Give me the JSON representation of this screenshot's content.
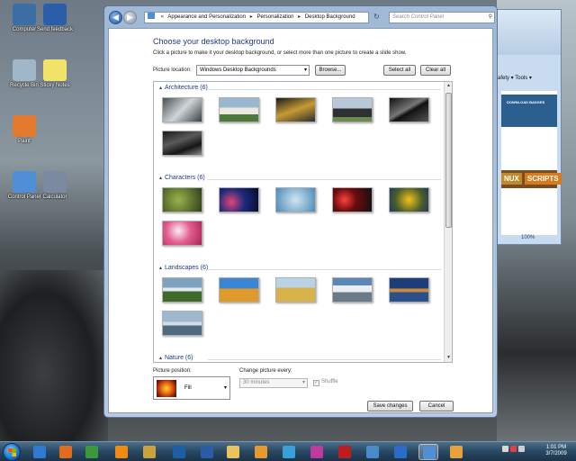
{
  "desktop": {
    "icons": [
      {
        "label": "Computer",
        "name": "computer-icon",
        "color": "#3a6ea5"
      },
      {
        "label": "Send feedback",
        "name": "send-feedback-icon",
        "color": "#2b5ea8"
      },
      {
        "label": "Recycle Bin",
        "name": "recycle-bin-icon",
        "color": "#9fb7c9"
      },
      {
        "label": "Sticky Notes",
        "name": "sticky-notes-icon",
        "color": "#f2e36b"
      },
      {
        "label": "Paint",
        "name": "paint-icon",
        "color": "#e27b2d"
      },
      {
        "label": "Control Panel",
        "name": "control-panel-icon",
        "color": "#4f8fd6"
      },
      {
        "label": "Calculator",
        "name": "calculator-icon",
        "color": "#7c8aa0"
      }
    ]
  },
  "ie_window": {
    "tools_label": "afety ▾   Tools ▾",
    "band_text": "DOWNLOAD BADGES",
    "linux_text": "NUX",
    "scripts_text": "SCRIPTS",
    "zoom": "100%"
  },
  "window": {
    "address": {
      "icon": "control-panel-icon",
      "crumbs": [
        "Appearance and Personalization",
        "Personalization",
        "Desktop Background"
      ]
    },
    "search_placeholder": "Search Control Panel",
    "heading": "Choose your desktop background",
    "subtext": "Click a picture to make it your desktop background, or select more than one picture to create a slide show.",
    "location_label": "Picture location:",
    "location_value": "Windows Desktop Backgrounds",
    "browse_label": "Browse...",
    "select_all_label": "Select all",
    "clear_all_label": "Clear all",
    "groups": [
      {
        "title": "Architecture (6)",
        "thumbs": [
          {
            "name": "thumb-arch-1",
            "bg": "linear-gradient(135deg,#4a4f52,#cfd5d8 50%,#3c3f40)"
          },
          {
            "name": "thumb-arch-2",
            "bg": "linear-gradient(180deg,#9ab7d0 0 40%,#ece7df 40% 70%,#4d7a3a 70%)"
          },
          {
            "name": "thumb-arch-3",
            "bg": "linear-gradient(160deg,#1a1a1a,#c79b34 50%,#2d2d2d)"
          },
          {
            "name": "thumb-arch-4",
            "bg": "linear-gradient(180deg,#b7c9d8 0 45%,#2e3032 45% 80%,#6c8a4e 80%)"
          },
          {
            "name": "thumb-arch-5",
            "bg": "linear-gradient(150deg,#111,#777 45%,#111 55%,#555)"
          },
          {
            "name": "thumb-arch-6",
            "bg": "linear-gradient(160deg,#1a1a1a,#5a5a5a 40%,#151515 70%,#8a8a8a)"
          }
        ]
      },
      {
        "title": "Characters (6)",
        "thumbs": [
          {
            "name": "thumb-char-1",
            "bg": "radial-gradient(circle at 40% 50%,#9ab34a,#2f3f1a)"
          },
          {
            "name": "thumb-char-2",
            "bg": "radial-gradient(circle at 30% 60%,#e0457b,#1b2a7a 45%,#050a2a)"
          },
          {
            "name": "thumb-char-3",
            "bg": "radial-gradient(circle at 50% 50%,#cfe5f0,#4b8ab8)"
          },
          {
            "name": "thumb-char-4",
            "bg": "radial-gradient(circle at 30% 50%,#ff4040,#6a0c0c 40%,#111)"
          },
          {
            "name": "thumb-char-5",
            "bg": "radial-gradient(circle at 50% 50%,#f2c21b,#4a5d2a 60%,#223b5e)"
          },
          {
            "name": "thumb-char-6",
            "bg": "radial-gradient(circle at 40% 40%,#f7f0f3,#e35d8f 45%,#a8244f)"
          }
        ]
      },
      {
        "title": "Landscapes (6)",
        "thumbs": [
          {
            "name": "thumb-land-1",
            "bg": "linear-gradient(180deg,#7ea2c0 0 40%,#dfe9ef 40% 55%,#3f6a2a 55%)"
          },
          {
            "name": "thumb-land-2",
            "bg": "linear-gradient(180deg,#3a86d2 0 45%,#e09a2c 45%)"
          },
          {
            "name": "thumb-land-3",
            "bg": "linear-gradient(180deg,#b9d2e6 0 40%,#d9b24a 40%)"
          },
          {
            "name": "thumb-land-4",
            "bg": "linear-gradient(180deg,#5a86b8 0 30%,#e8eef2 30% 60%,#6b7a88 60%)"
          },
          {
            "name": "thumb-land-5",
            "bg": "linear-gradient(180deg,#1e3c7a 0 45%,#c58a3a 45% 60%,#2b4f8a 60%)"
          },
          {
            "name": "thumb-land-6",
            "bg": "linear-gradient(180deg,#9fb8cf 0 45%,#d4dde5 45% 60%,#4f6a7e 60%)"
          }
        ]
      },
      {
        "title": "Nature (6)",
        "thumbs": [
          {
            "name": "thumb-nat-1",
            "bg": "radial-gradient(circle at 50% 80%,#f18cb0,#b83565)"
          },
          {
            "name": "thumb-nat-2",
            "bg": "radial-gradient(circle at 50% 80%,#ffe680,#f2a11c)"
          },
          {
            "name": "thumb-nat-3",
            "bg": "linear-gradient(180deg,#b9a27a,#e0cfaa)"
          },
          {
            "name": "thumb-nat-4",
            "bg": "radial-gradient(circle at 40% 80%,#ffe14a,#e08a1a)"
          },
          {
            "name": "thumb-nat-5",
            "bg": "linear-gradient(180deg,#264a25,#8bb356)"
          }
        ]
      }
    ],
    "position_label": "Picture position:",
    "position_value": "Fill",
    "change_label": "Change picture every:",
    "change_value": "30 minutes",
    "shuffle_label": "Shuffle",
    "save_label": "Save changes",
    "cancel_label": "Cancel"
  },
  "taskbar": {
    "items": [
      {
        "name": "ie-taskbar-icon",
        "color": "#2f7bd4",
        "active": false
      },
      {
        "name": "firefox-taskbar-icon",
        "color": "#e36b1c",
        "active": false
      },
      {
        "name": "media-center-taskbar-icon",
        "color": "#3a9a3a",
        "active": false
      },
      {
        "name": "vlc-taskbar-icon",
        "color": "#f08a10",
        "active": false
      },
      {
        "name": "tool-taskbar-icon",
        "color": "#c9a23a",
        "active": false
      },
      {
        "name": "photoshop-taskbar-icon",
        "color": "#1c5fa6",
        "active": false
      },
      {
        "name": "word-taskbar-icon",
        "color": "#2a5caa",
        "active": false
      },
      {
        "name": "explorer-taskbar-icon",
        "color": "#e8c45a",
        "active": false
      },
      {
        "name": "media-player-taskbar-icon",
        "color": "#e9982b",
        "active": false
      },
      {
        "name": "app-taskbar-icon",
        "color": "#3aa0d8",
        "active": false
      },
      {
        "name": "paint-taskbar-icon",
        "color": "#c0399c",
        "active": false
      },
      {
        "name": "filezilla-taskbar-icon",
        "color": "#bf1d1d",
        "active": false
      },
      {
        "name": "network-taskbar-icon",
        "color": "#4a8ac9",
        "active": false
      },
      {
        "name": "help-taskbar-icon",
        "color": "#2c6cc8",
        "active": false
      },
      {
        "name": "control-panel-taskbar-icon",
        "color": "#4f8fd6",
        "active": true
      },
      {
        "name": "media-taskbar-icon",
        "color": "#e8a23a",
        "active": false
      }
    ],
    "time": "1:01 PM",
    "date": "3/7/2009"
  }
}
